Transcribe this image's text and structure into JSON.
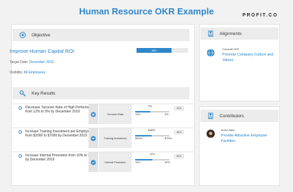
{
  "header": {
    "title": "Human Resource OKR Example",
    "brand": "PROFIT.CO"
  },
  "objective": {
    "section_label": "Objective",
    "title": "Improve Human Capital ROI",
    "progress_label": "68%",
    "progress": 0.68,
    "target_label": "Target Date:",
    "target_value": "December 2019",
    "visibility_label": "Visibility:",
    "visibility_value": "All Employees"
  },
  "key_results": {
    "section_label": "Key Results",
    "items": [
      {
        "text": "Decrease Turnover Rate of High Performers from 12% to 5% by December 2019",
        "name": "Turnover Rate",
        "current": "9%",
        "start": "12%",
        "end": "5%",
        "progress_label": "43%",
        "progress": 0.43
      },
      {
        "text": "Increase Training Investment per Employee from $2000 to $7000 by December 2019",
        "name": "Training Investment",
        "current": "$4600",
        "start": "$2000",
        "end": "$7000",
        "progress_label": "48%",
        "progress": 0.48
      },
      {
        "text": "Increase Internal Promotion from 10% to 30% by December 2019",
        "name": "Internal Promotion",
        "current": "20%",
        "start": "10%",
        "end": "30%",
        "progress_label": "50%",
        "progress": 0.5
      }
    ]
  },
  "alignments": {
    "section_label": "Alignments",
    "kind": "Corporate OKR",
    "link": "Promote Company Culture and Values"
  },
  "contributors": {
    "section_label": "Contributors",
    "person": "Amber Baker",
    "link": "Provide Attractive Employee Facilities"
  },
  "colors": {
    "accent": "#2e86c9",
    "panel_head": "#ececec",
    "background": "#f2f2f2"
  },
  "icons": {
    "objective": "target-icon",
    "key_results": "key-icon",
    "alignments": "hourglass-icon",
    "contributors": "hourglass-icon",
    "alignment_item": "globe-icon",
    "kr_rows": [
      "cross-icon",
      "graduation-cap-icon",
      "trend-up-icon"
    ]
  }
}
